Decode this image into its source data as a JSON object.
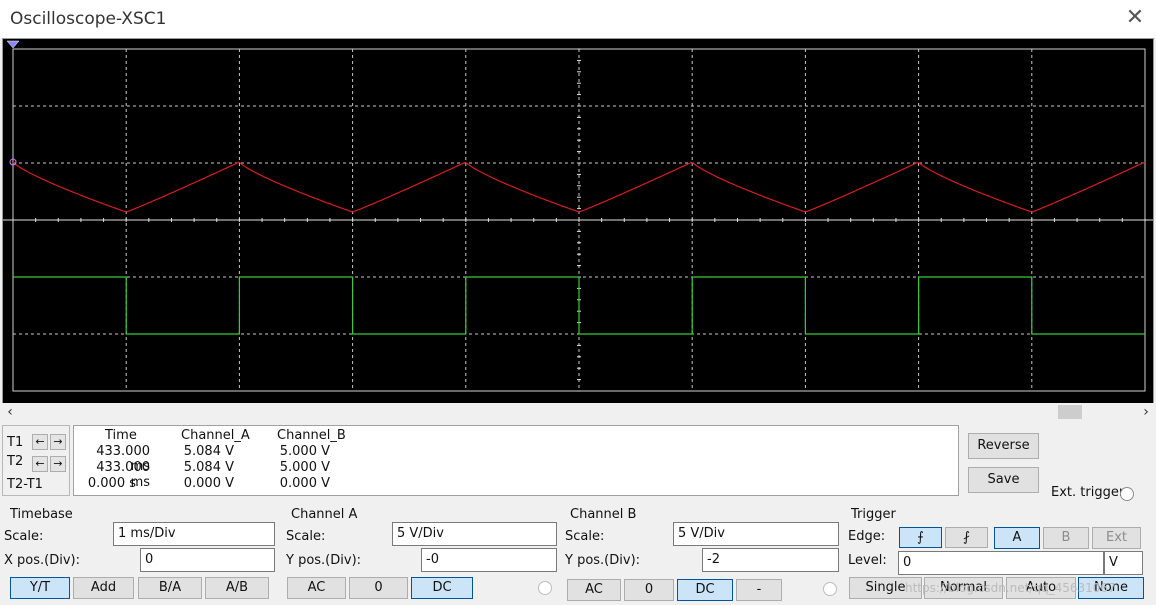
{
  "window": {
    "title": "Oscilloscope-XSC1",
    "close_glyph": "✕"
  },
  "screen": {
    "background": "#000000",
    "grid_color": "#c8c8c8",
    "channel_a_color": "#d42020",
    "channel_b_color": "#3cc83c",
    "timebase_ms_per_div": 1,
    "channel_a": {
      "volts_per_div": 5,
      "position_div": 0,
      "waveform": "triangle-like",
      "max_v": 5.084,
      "min_v": 0.7,
      "period_ms": 2
    },
    "channel_b": {
      "volts_per_div": 5,
      "position_div": -2,
      "waveform": "square",
      "high_v": 5.0,
      "low_v": 0.0,
      "period_ms": 2
    }
  },
  "scrollbar": {
    "left_arrow": "‹",
    "right_arrow": "›"
  },
  "cursors": {
    "t1_label": "T1",
    "t2_label": "T2",
    "t2t1_label": "T2-T1",
    "left_arrow": "←",
    "right_arrow": "→"
  },
  "readout": {
    "headers": [
      "Time",
      "Channel_A",
      "Channel_B"
    ],
    "rows": [
      [
        "433.000 ms",
        "5.084 V",
        "5.000 V"
      ],
      [
        "433.000 ms",
        "5.084 V",
        "5.000 V"
      ],
      [
        "0.000 s",
        "0.000 V",
        "0.000 V"
      ]
    ]
  },
  "actions": {
    "reverse": "Reverse",
    "save": "Save",
    "ext_trigger": "Ext. trigger"
  },
  "timebase": {
    "group": "Timebase",
    "scale_label": "Scale:",
    "scale_value": "1 ms/Div",
    "xpos_label": "X pos.(Div):",
    "xpos_value": "0",
    "modes": [
      "Y/T",
      "Add",
      "B/A",
      "A/B"
    ],
    "selected_mode": "Y/T"
  },
  "channel_a": {
    "group": "Channel A",
    "scale_label": "Scale:",
    "scale_value": "5  V/Div",
    "ypos_label": "Y pos.(Div):",
    "ypos_value": "-0",
    "coupling": [
      "AC",
      "0",
      "DC"
    ],
    "selected": "DC"
  },
  "channel_b": {
    "group": "Channel B",
    "scale_label": "Scale:",
    "scale_value": "5  V/Div",
    "ypos_label": "Y pos.(Div):",
    "ypos_value": "-2",
    "coupling": [
      "AC",
      "0",
      "DC",
      "-"
    ],
    "selected": "DC"
  },
  "trigger": {
    "group": "Trigger",
    "edge_label": "Edge:",
    "rising_glyph": "⨍",
    "falling_glyph": "⨏",
    "sources": [
      "A",
      "B",
      "Ext"
    ],
    "selected_source": "A",
    "level_label": "Level:",
    "level_value": "0",
    "level_unit": "V",
    "modes": [
      "Single",
      "Normal",
      "Auto",
      "None"
    ]
  },
  "watermark": "https://blog.csdn.net/qq_45631067"
}
